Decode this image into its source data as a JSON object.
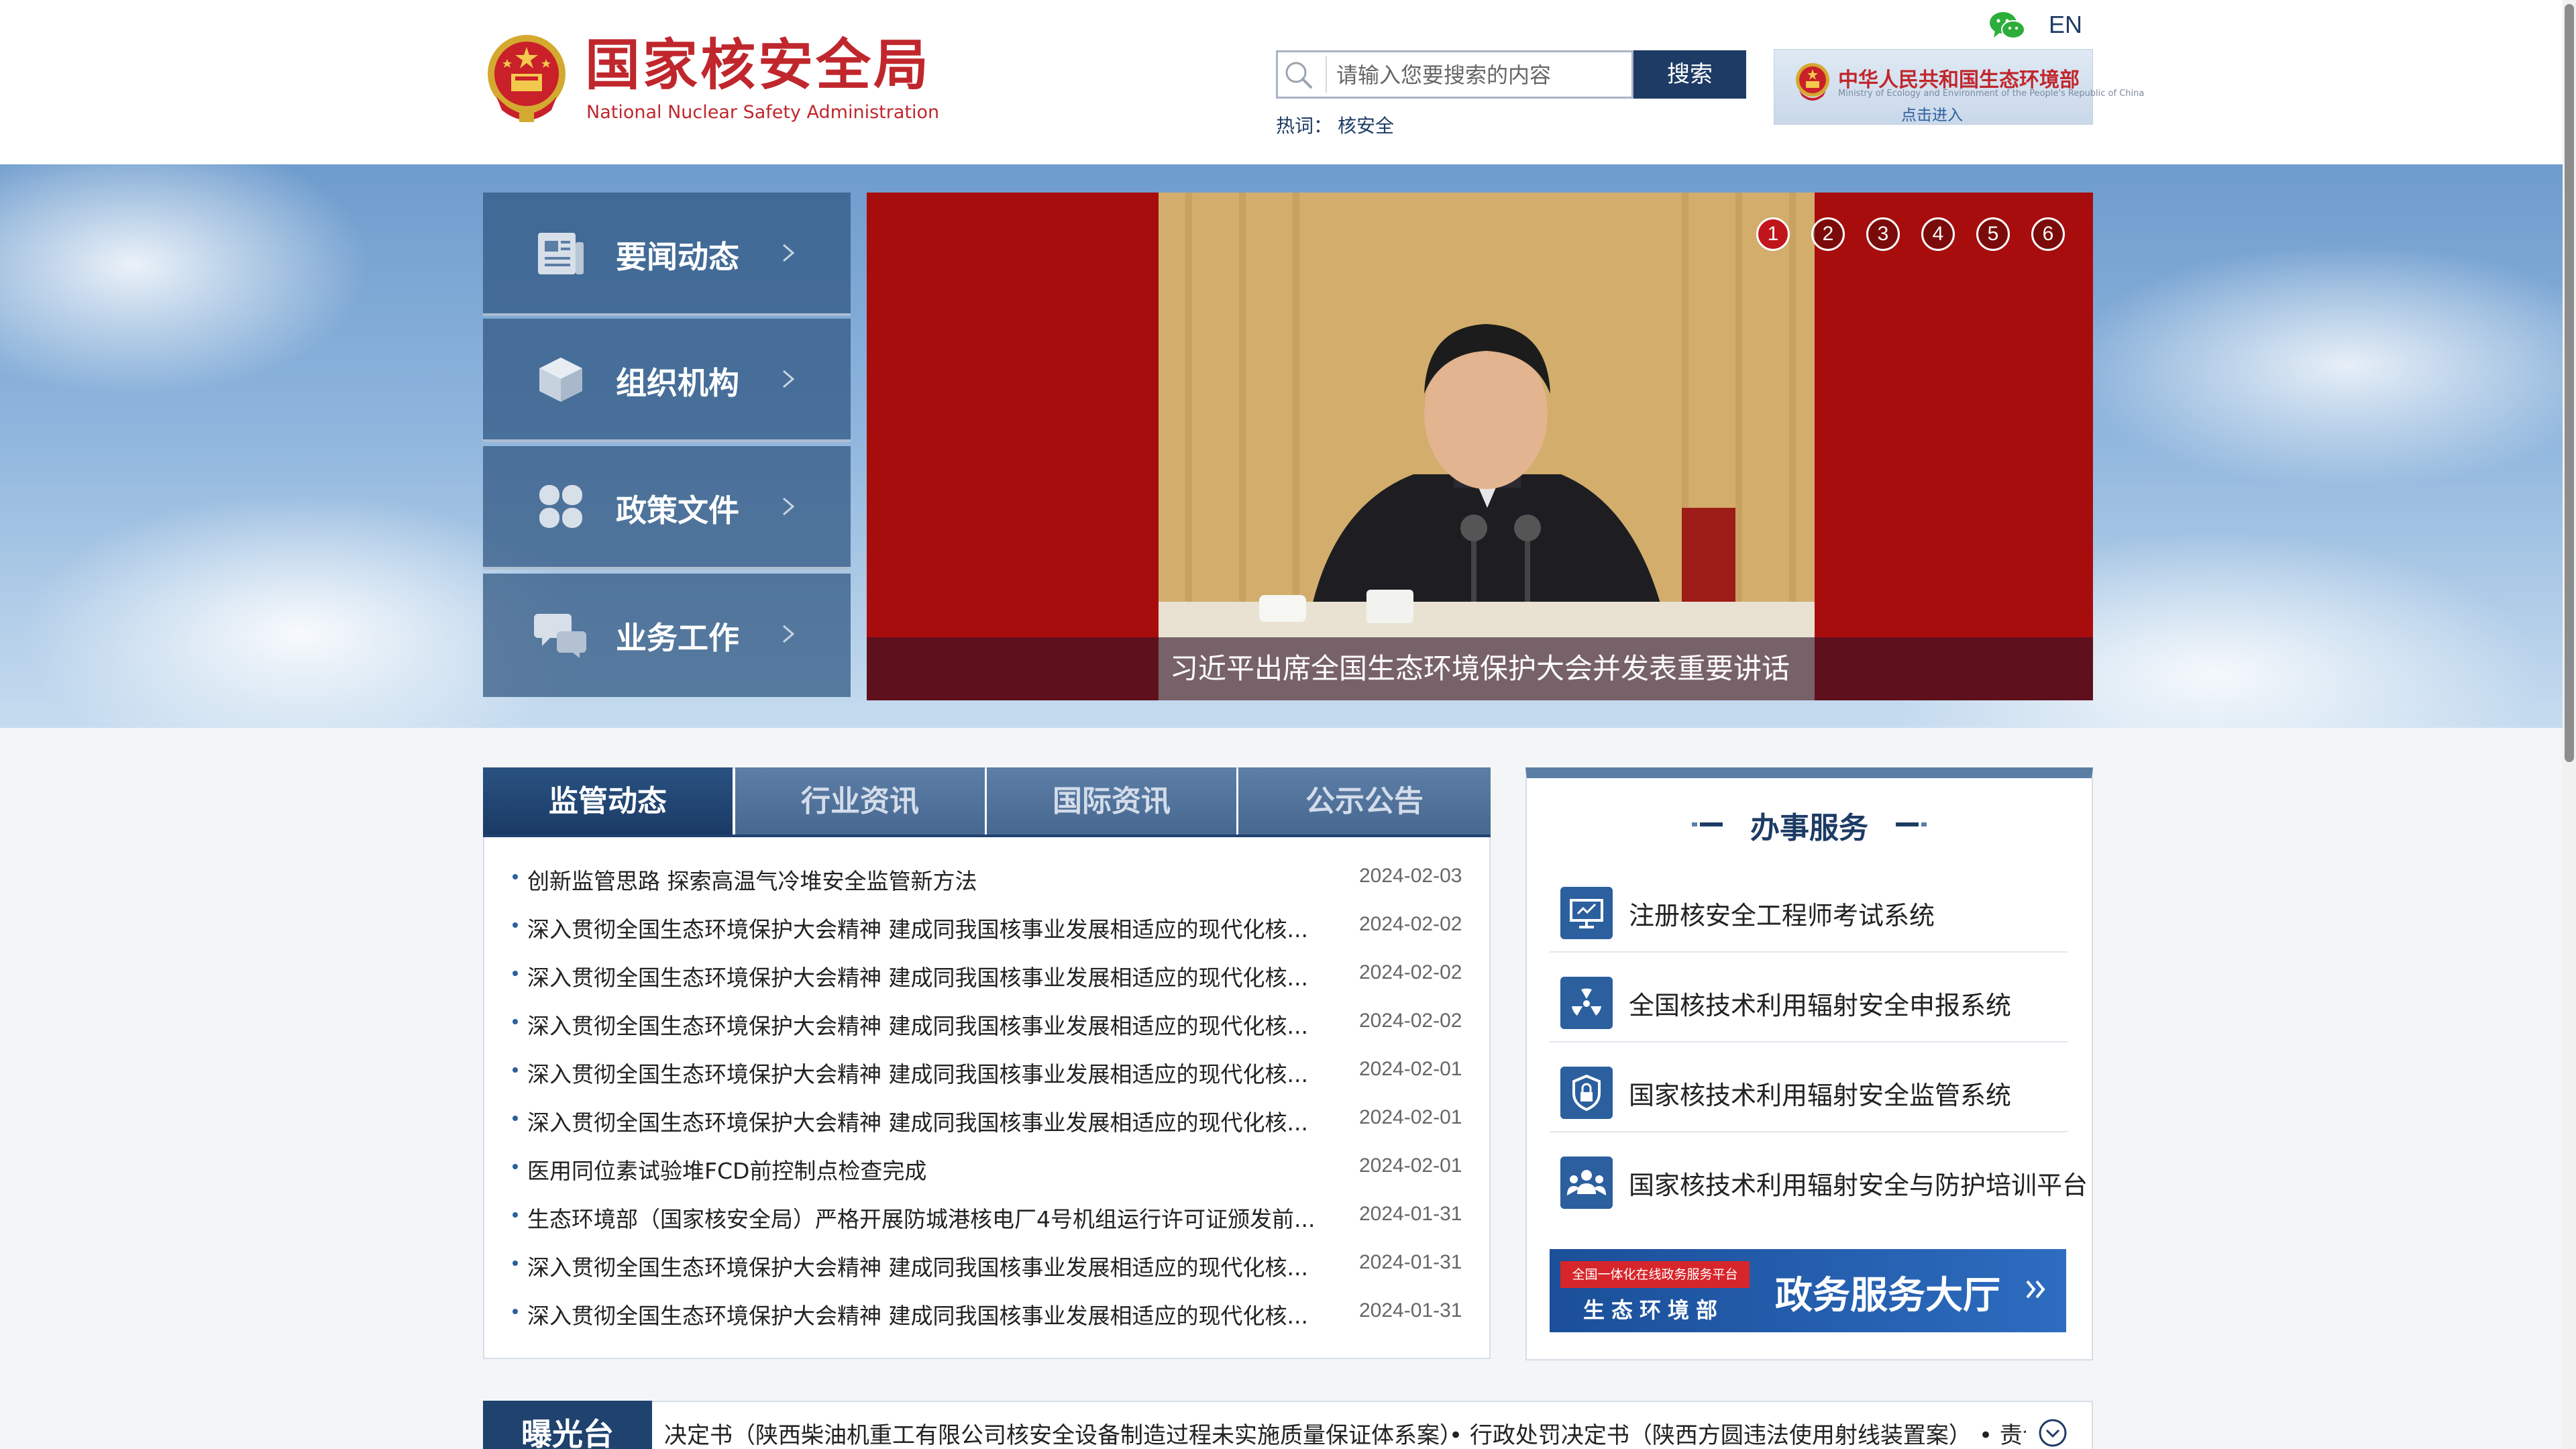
{
  "header": {
    "logo_cn": "国家核安全局",
    "logo_en": "National Nuclear Safety Administration",
    "lang_switch": "EN",
    "search": {
      "placeholder": "请输入您要搜索的内容",
      "button": "搜索"
    },
    "hot_words": {
      "label": "热词：",
      "items": [
        "核安全"
      ]
    },
    "mee_link": {
      "title": "中华人民共和国生态环境部",
      "subtitle": "Ministry of Ecology and Environment of the People's Republic of China",
      "enter": "点击进入"
    },
    "icons": {
      "wechat": "wechat-icon",
      "search": "search-icon",
      "emblem": "national-emblem-icon"
    }
  },
  "nav": [
    {
      "label": "要闻动态",
      "icon": "newspaper-icon"
    },
    {
      "label": "组织机构",
      "icon": "cube-icon"
    },
    {
      "label": "政策文件",
      "icon": "grid-petals-icon"
    },
    {
      "label": "业务工作",
      "icon": "chat-bubbles-icon"
    }
  ],
  "carousel": {
    "caption": "习近平出席全国生态环境保护大会并发表重要讲话",
    "dots": [
      "1",
      "2",
      "3",
      "4",
      "5",
      "6"
    ],
    "active_index": 0
  },
  "news": {
    "tabs": [
      "监管动态",
      "行业资讯",
      "国际资讯",
      "公示公告"
    ],
    "active_tab": 0,
    "items": [
      {
        "title": "创新监管思路 探索高温气冷堆安全监管新方法",
        "date": "2024-02-03"
      },
      {
        "title": "深入贯彻全国生态环境保护大会精神 建成同我国核事业发展相适应的现代化核...",
        "date": "2024-02-02"
      },
      {
        "title": "深入贯彻全国生态环境保护大会精神 建成同我国核事业发展相适应的现代化核...",
        "date": "2024-02-02"
      },
      {
        "title": "深入贯彻全国生态环境保护大会精神 建成同我国核事业发展相适应的现代化核...",
        "date": "2024-02-02"
      },
      {
        "title": "深入贯彻全国生态环境保护大会精神 建成同我国核事业发展相适应的现代化核...",
        "date": "2024-02-01"
      },
      {
        "title": "深入贯彻全国生态环境保护大会精神 建成同我国核事业发展相适应的现代化核...",
        "date": "2024-02-01"
      },
      {
        "title": "医用同位素试验堆FCD前控制点检查完成",
        "date": "2024-02-01"
      },
      {
        "title": "生态环境部（国家核安全局）严格开展防城港核电厂4号机组运行许可证颁发前...",
        "date": "2024-01-31"
      },
      {
        "title": "深入贯彻全国生态环境保护大会精神 建成同我国核事业发展相适应的现代化核...",
        "date": "2024-01-31"
      },
      {
        "title": "深入贯彻全国生态环境保护大会精神 建成同我国核事业发展相适应的现代化核...",
        "date": "2024-01-31"
      }
    ]
  },
  "services": {
    "title": "办事服务",
    "items": [
      {
        "label": "注册核安全工程师考试系统",
        "icon": "exam-monitor-icon"
      },
      {
        "label": "全国核技术利用辐射安全申报系统",
        "icon": "radiation-icon"
      },
      {
        "label": "国家核技术利用辐射安全监管系统",
        "icon": "shield-lock-icon"
      },
      {
        "label": "国家核技术利用辐射安全与防护培训平台",
        "icon": "people-training-icon"
      }
    ],
    "gov_banner": {
      "badge": "全国一体化在线政务服务平台",
      "dept": "生态环境部",
      "title": "政务服务大厅"
    }
  },
  "exposure": {
    "label": "曝光台",
    "items": [
      "决定书（陕西柴油机重工有限公司核安全设备制造过程未实施质量保证体系案）",
      "• 行政处罚决定书（陕西方圆违法使用射线装置案）",
      "• 责令"
    ]
  },
  "colors": {
    "brand_red": "#c0272d",
    "navy": "#1d3b64",
    "tab_active": "#1f426e",
    "carousel_red": "#a80d0d"
  }
}
